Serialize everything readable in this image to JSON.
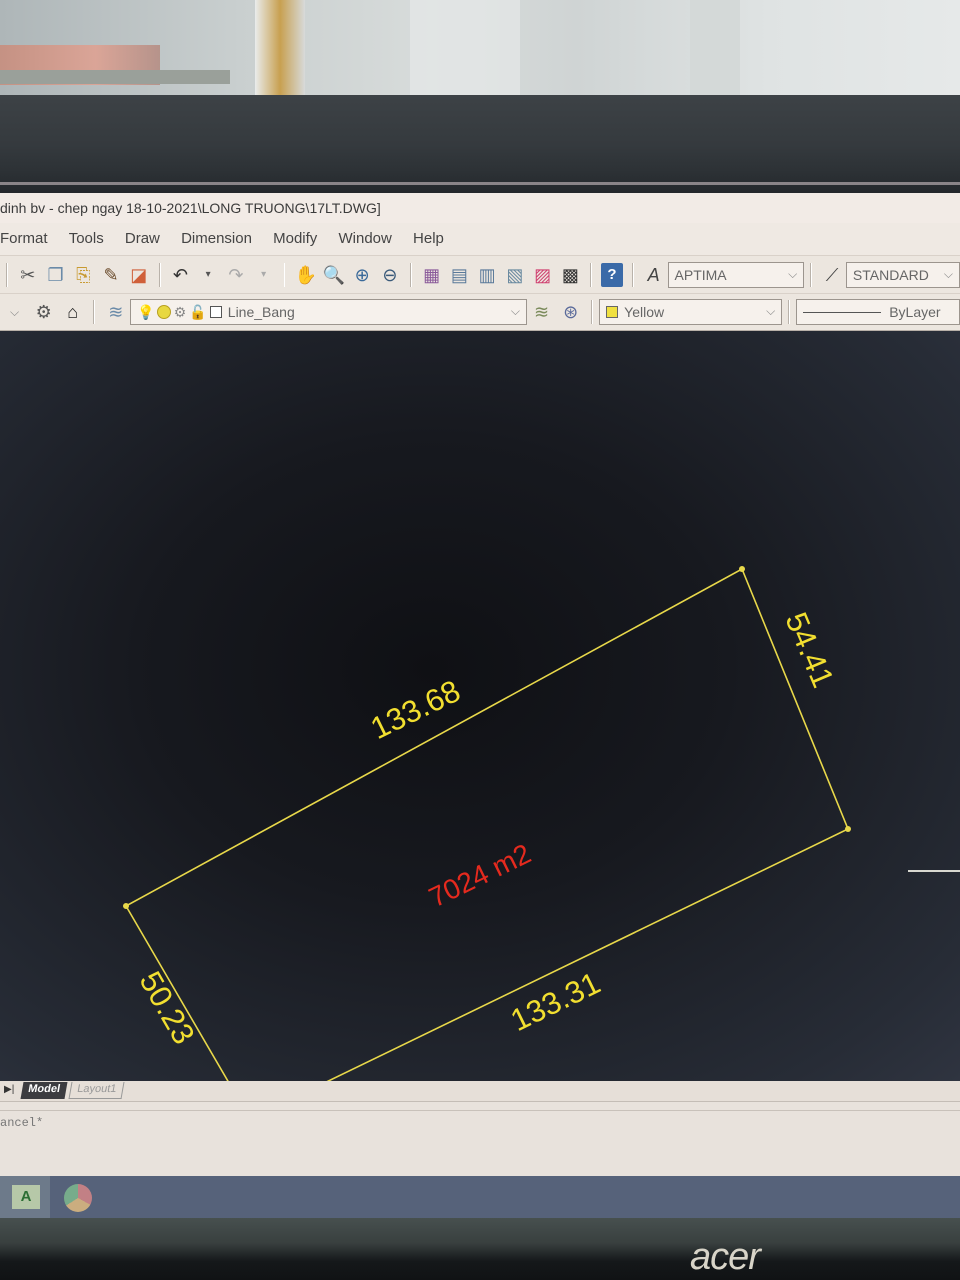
{
  "window": {
    "title": "dinh bv - chep ngay 18-10-2021\\LONG TRUONG\\17LT.DWG]"
  },
  "menu": {
    "items": [
      "Format",
      "Tools",
      "Draw",
      "Dimension",
      "Modify",
      "Window",
      "Help"
    ]
  },
  "toolbar_standard": {
    "icons": [
      "cut-icon",
      "copy-icon",
      "paste-icon",
      "match-properties-icon",
      "block-editor-icon",
      "undo-icon",
      "redo-icon",
      "pan-icon",
      "zoom-realtime-icon",
      "zoom-window-icon",
      "zoom-previous-icon",
      "design-center-icon",
      "properties-icon",
      "tool-palettes-icon",
      "sheet-set-icon",
      "markup-icon",
      "calculator-icon",
      "help-icon"
    ],
    "text_style_select": "APTIMA",
    "dim_style_select": "STANDARD"
  },
  "toolbar_layers": {
    "layer_select": "Line_Bang",
    "color_select": "Yellow",
    "color_swatch": "#f0e040",
    "linetype_select": "ByLayer"
  },
  "drawing": {
    "line_color": "#e8d84a",
    "dimension_color": "#f2df30",
    "area_color": "#e52a1e",
    "dimensions": {
      "top": "133.68",
      "right": "54.41",
      "bottom": "133.31",
      "left": "50.23"
    },
    "area_label": "7024 m2"
  },
  "layout_tabs": {
    "model": "Model",
    "layout1": "Layout1"
  },
  "command_line": {
    "history": "ancel*"
  },
  "taskbar": {
    "apps": [
      "autocad-app-icon",
      "chrome-icon"
    ]
  },
  "monitor": {
    "brand": "acer"
  }
}
